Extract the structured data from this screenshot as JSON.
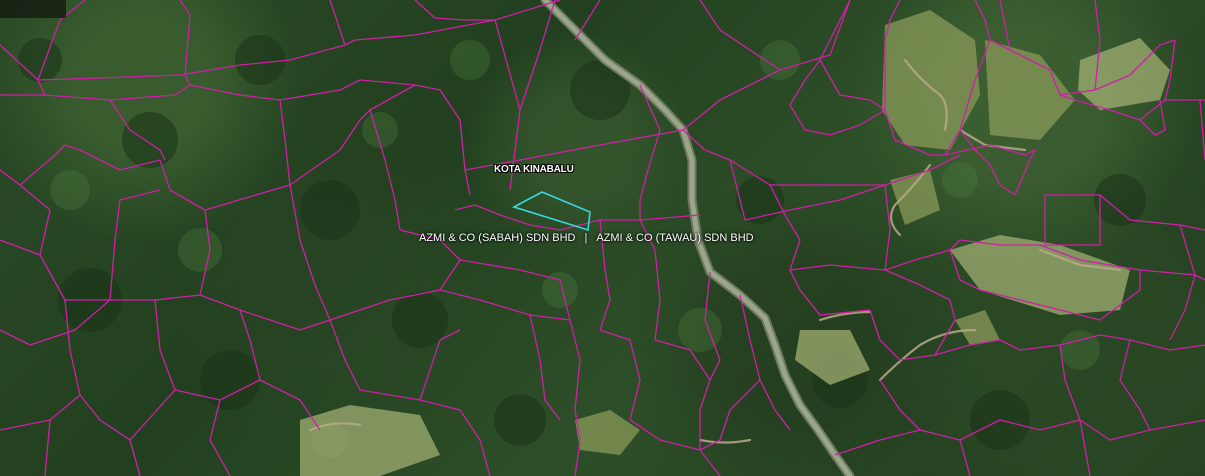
{
  "map": {
    "place_label": "KOTA KINABALU",
    "company_label": {
      "left": "AZMI & CO (SABAH) SDN BHD",
      "separator": "|",
      "right": "AZMI & CO (TAWAU) SDN BHD"
    },
    "colors": {
      "parcel_boundary": "#d01fa6",
      "selected_parcel": "#35d9e0",
      "label_text": "#ffffff"
    }
  }
}
